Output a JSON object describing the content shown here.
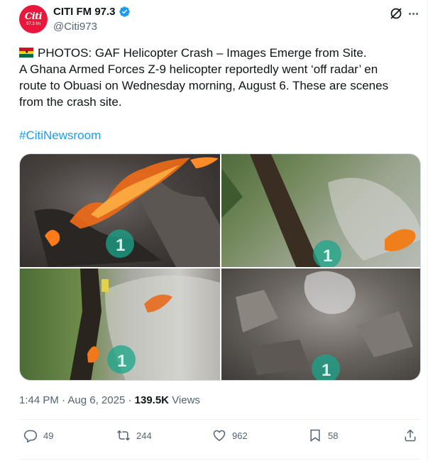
{
  "author": {
    "display_name": "CITI FM 97.3",
    "handle": "@Citi973",
    "avatar_text": "Citi",
    "avatar_sub": "97.3 fm",
    "verified": true
  },
  "tweet": {
    "headline": "PHOTOS: GAF Helicopter Crash – Images Emerge from Site.",
    "body": "A Ghana Armed Forces Z-9 helicopter reportedly went ‘off radar’ en route to Obuasi on Wednesday morning, August 6. These are scenes from the crash site.",
    "hashtag": "#CitiNewsroom",
    "time": "1:44 PM",
    "date": "Aug 6, 2025",
    "views_count": "139.5K",
    "views_label": "Views"
  },
  "actions": {
    "replies": "49",
    "reposts": "244",
    "likes": "962",
    "bookmarks": "58"
  },
  "icons": [
    "verified-badge-icon",
    "grok-icon",
    "more-icon",
    "reply-icon",
    "retweet-icon",
    "like-icon",
    "bookmark-icon",
    "share-icon"
  ],
  "colors": {
    "accent": "#1d9bf0",
    "secondary_text": "#536471",
    "brand_red": "#e8173b"
  }
}
